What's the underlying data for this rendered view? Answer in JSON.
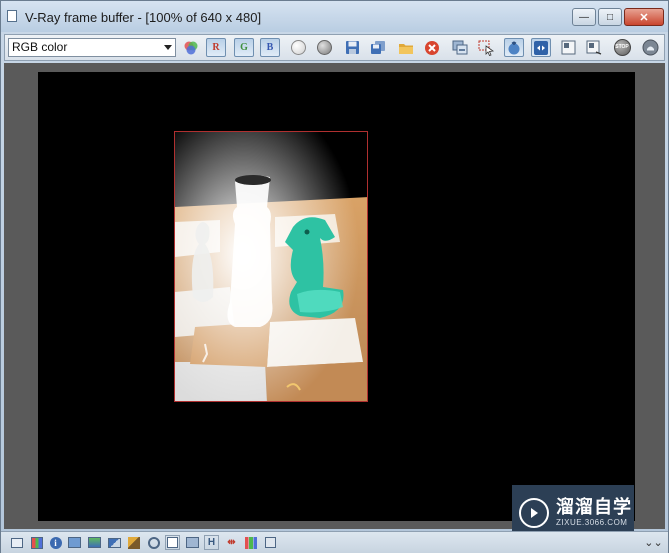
{
  "window": {
    "title": "V-Ray frame buffer - [100% of 640 x 480]",
    "minimize_glyph": "—",
    "maximize_glyph": "□",
    "close_glyph": "✕"
  },
  "toolbar": {
    "channel": {
      "selected": "RGB color"
    },
    "color_channels": {
      "red": "R",
      "green": "G",
      "blue": "B"
    },
    "stop_label": "STOP"
  },
  "statusbar": {
    "histogram_label": "H"
  },
  "watermark": {
    "name": "溜溜自学",
    "url": "ZIXUE.3066.COM"
  },
  "colors": {
    "titlebar": "#c9d8e8",
    "canvas": "#000000",
    "main_area": "#5a5a5a",
    "region_border": "#b03030",
    "watermark_bg": "#2c3f55"
  }
}
